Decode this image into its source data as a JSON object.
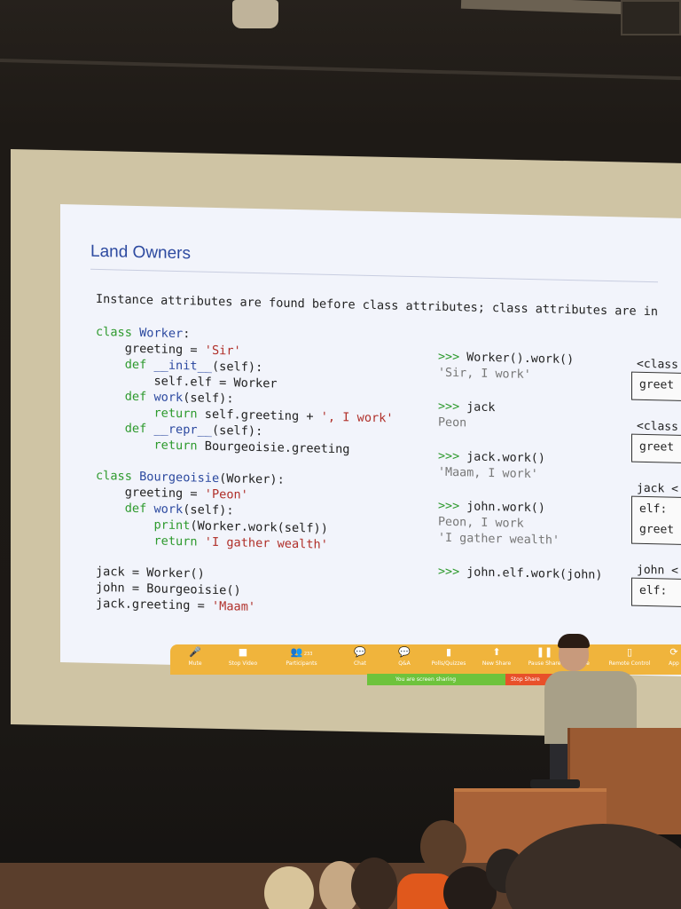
{
  "slide": {
    "title": "Land Owners",
    "subtitle": "Instance attributes are found before class attributes; class attributes are in",
    "code": [
      {
        "parts": [
          {
            "t": "class ",
            "c": "kw"
          },
          {
            "t": "Worker",
            "c": "fn"
          },
          {
            "t": ":",
            "c": ""
          }
        ]
      },
      {
        "parts": [
          {
            "t": "    greeting = ",
            "c": ""
          },
          {
            "t": "'Sir'",
            "c": "str"
          }
        ]
      },
      {
        "parts": [
          {
            "t": "    ",
            "c": ""
          },
          {
            "t": "def ",
            "c": "kw"
          },
          {
            "t": "__init__",
            "c": "fn"
          },
          {
            "t": "(self):",
            "c": ""
          }
        ]
      },
      {
        "parts": [
          {
            "t": "        self.elf = Worker",
            "c": ""
          }
        ]
      },
      {
        "parts": [
          {
            "t": "    ",
            "c": ""
          },
          {
            "t": "def ",
            "c": "kw"
          },
          {
            "t": "work",
            "c": "fn"
          },
          {
            "t": "(self):",
            "c": ""
          }
        ]
      },
      {
        "parts": [
          {
            "t": "        ",
            "c": ""
          },
          {
            "t": "return ",
            "c": "kw"
          },
          {
            "t": "self.greeting + ",
            "c": ""
          },
          {
            "t": "', I work'",
            "c": "str"
          }
        ]
      },
      {
        "parts": [
          {
            "t": "    ",
            "c": ""
          },
          {
            "t": "def ",
            "c": "kw"
          },
          {
            "t": "__repr__",
            "c": "fn"
          },
          {
            "t": "(self):",
            "c": ""
          }
        ]
      },
      {
        "parts": [
          {
            "t": "        ",
            "c": ""
          },
          {
            "t": "return ",
            "c": "kw"
          },
          {
            "t": "Bourgeoisie.greeting",
            "c": ""
          }
        ]
      },
      {
        "parts": []
      },
      {
        "parts": [
          {
            "t": "class ",
            "c": "kw"
          },
          {
            "t": "Bourgeoisie",
            "c": "fn"
          },
          {
            "t": "(Worker):",
            "c": ""
          }
        ]
      },
      {
        "parts": [
          {
            "t": "    greeting = ",
            "c": ""
          },
          {
            "t": "'Peon'",
            "c": "str"
          }
        ]
      },
      {
        "parts": [
          {
            "t": "    ",
            "c": ""
          },
          {
            "t": "def ",
            "c": "kw"
          },
          {
            "t": "work",
            "c": "fn"
          },
          {
            "t": "(self):",
            "c": ""
          }
        ]
      },
      {
        "parts": [
          {
            "t": "        ",
            "c": ""
          },
          {
            "t": "print",
            "c": "kw"
          },
          {
            "t": "(Worker.work(self))",
            "c": ""
          }
        ]
      },
      {
        "parts": [
          {
            "t": "        ",
            "c": ""
          },
          {
            "t": "return ",
            "c": "kw"
          },
          {
            "t": "'I gather wealth'",
            "c": "str"
          }
        ]
      },
      {
        "parts": []
      },
      {
        "parts": [
          {
            "t": "jack = Worker()",
            "c": ""
          }
        ]
      },
      {
        "parts": [
          {
            "t": "john = Bourgeoisie()",
            "c": ""
          }
        ]
      },
      {
        "parts": [
          {
            "t": "jack.greeting = ",
            "c": ""
          },
          {
            "t": "'Maam'",
            "c": "str"
          }
        ]
      }
    ],
    "repl": [
      {
        "cmd": "Worker().work()",
        "out": [
          "'Sir, I work'"
        ]
      },
      {
        "cmd": "jack",
        "out": [
          "Peon"
        ]
      },
      {
        "cmd": "jack.work()",
        "out": [
          "'Maam, I work'"
        ]
      },
      {
        "cmd": "john.work()",
        "out": [
          "Peon, I work",
          "'I gather wealth'"
        ]
      },
      {
        "cmd": "john.elf.work(john)",
        "out": []
      }
    ],
    "prompt": ">>> ",
    "diagram": {
      "label_class_1": "<class",
      "box_class_1": "greet",
      "label_class_2": "<class",
      "box_class_2": "greet",
      "label_jack": "jack <",
      "box_jack_1": "elf:",
      "box_jack_2": "greet",
      "label_john": "john <",
      "box_john": "elf:"
    }
  },
  "zoom_toolbar": {
    "buttons": [
      {
        "name": "mute",
        "label": "Mute",
        "icon": "microphone-icon",
        "glyph": "🎤"
      },
      {
        "name": "stop-video",
        "label": "Stop Video",
        "icon": "video-camera-icon",
        "glyph": "■"
      },
      {
        "name": "participants",
        "label": "Participants",
        "icon": "people-icon",
        "glyph": "👥",
        "badge": "233"
      },
      {
        "name": "chat",
        "label": "Chat",
        "icon": "chat-bubble-icon",
        "glyph": "💬"
      },
      {
        "name": "qa",
        "label": "Q&A",
        "icon": "qa-bubble-icon",
        "glyph": "💬"
      },
      {
        "name": "polls",
        "label": "Polls/Quizzes",
        "icon": "bar-chart-icon",
        "glyph": "▮"
      },
      {
        "name": "new-share",
        "label": "New Share",
        "icon": "share-arrow-icon",
        "glyph": "⬆"
      },
      {
        "name": "pause-share",
        "label": "Pause Share",
        "icon": "pause-icon",
        "glyph": "❚❚"
      },
      {
        "name": "annotate",
        "label": "ate",
        "icon": "pen-icon",
        "glyph": "✎"
      },
      {
        "name": "remote-control",
        "label": "Remote Control",
        "icon": "mouse-icon",
        "glyph": "▯"
      },
      {
        "name": "apps",
        "label": "App",
        "icon": "apps-icon",
        "glyph": "⟳"
      }
    ],
    "sharing_status": "You are screen sharing",
    "stop_share_label": "Stop Share",
    "colors": {
      "bar": "#f0b43c",
      "share_green": "#6ec33c",
      "stop_red": "#e8502a"
    }
  },
  "colors": {
    "slide_bg": "#f2f4fb",
    "keyword": "#2e9a2e",
    "function_name": "#2d4aa0",
    "string": "#b0302a",
    "output": "#777777",
    "podium": "#9a5a32"
  }
}
